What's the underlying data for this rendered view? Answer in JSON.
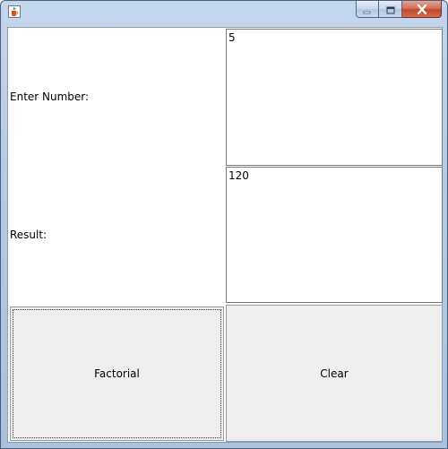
{
  "window": {
    "app_icon": "java-cup-icon",
    "controls": [
      "minimize-icon",
      "maximize-icon",
      "close-icon"
    ]
  },
  "form": {
    "input_label": "Enter Number:",
    "input_value": "5",
    "result_label": "Result:",
    "result_value": "120"
  },
  "buttons": {
    "factorial_label": "Factorial",
    "clear_label": "Clear"
  }
}
